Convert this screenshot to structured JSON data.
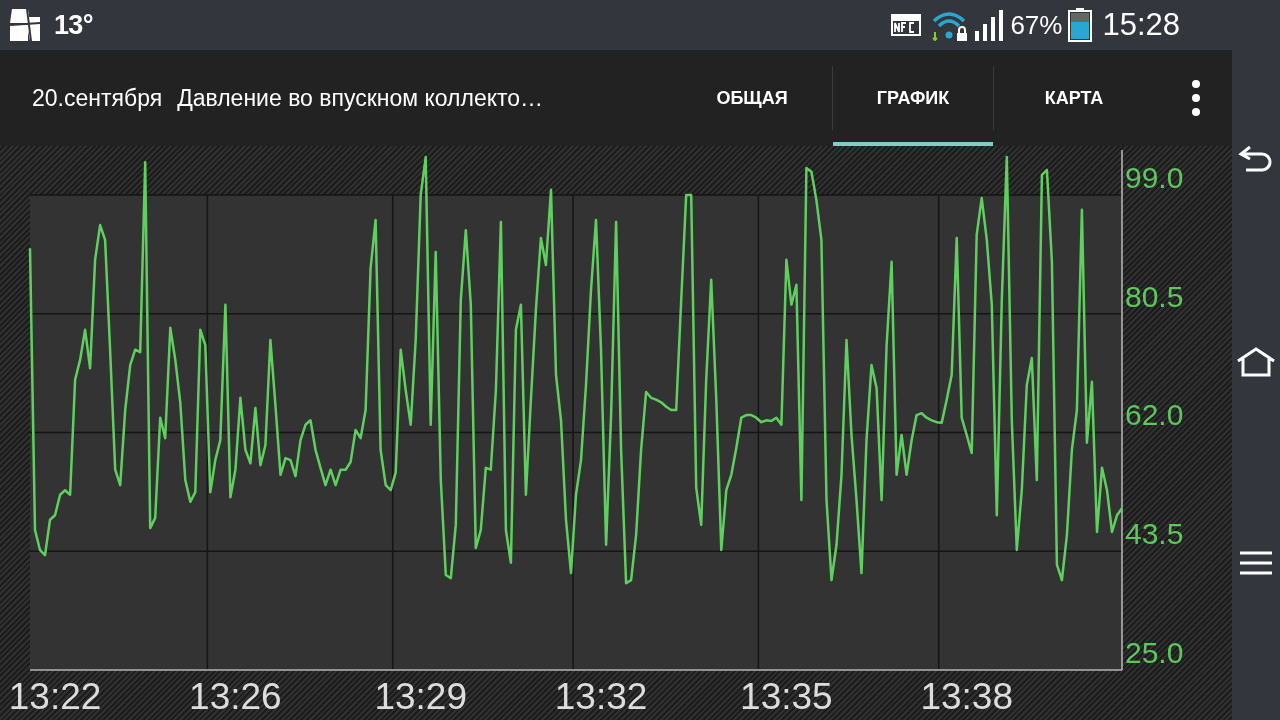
{
  "status_bar": {
    "temperature": "13°",
    "battery": "67%",
    "time": "15:28"
  },
  "action_bar": {
    "date": "20.сентября",
    "title": "Давление во впускном коллекто…",
    "tabs": [
      {
        "label": "ОБЩАЯ",
        "selected": false
      },
      {
        "label": "ГРАФИК",
        "selected": true
      },
      {
        "label": "КАРТА",
        "selected": false
      }
    ]
  },
  "chart_data": {
    "type": "line",
    "grid": true,
    "ylim": [
      25,
      106
    ],
    "categories": [
      null,
      null,
      null,
      null,
      null,
      "13:22",
      null,
      null,
      null,
      null,
      null,
      null,
      null,
      null,
      null,
      null,
      null,
      null,
      null,
      null,
      null,
      null,
      null,
      null,
      null,
      null,
      null,
      null,
      null,
      null,
      null,
      null,
      null,
      null,
      null,
      null,
      null,
      null,
      null,
      null,
      null,
      "13:26",
      null,
      null,
      null,
      null,
      null,
      null,
      null,
      null,
      null,
      null,
      null,
      null,
      null,
      null,
      null,
      null,
      null,
      null,
      null,
      null,
      null,
      null,
      null,
      null,
      null,
      null,
      null,
      null,
      null,
      null,
      null,
      null,
      null,
      null,
      null,
      null,
      "13:29",
      null,
      null,
      null,
      null,
      null,
      null,
      null,
      null,
      null,
      null,
      null,
      null,
      null,
      null,
      null,
      null,
      null,
      null,
      null,
      null,
      null,
      null,
      null,
      null,
      null,
      null,
      null,
      null,
      null,
      null,
      null,
      null,
      null,
      null,
      null,
      "13:32",
      null,
      null,
      null,
      null,
      null,
      null,
      null,
      null,
      null,
      null,
      null,
      null,
      null,
      null,
      null,
      null,
      null,
      null,
      null,
      null,
      null,
      null,
      null,
      null,
      null,
      null,
      null,
      null,
      null,
      null,
      null,
      null,
      null,
      null,
      null,
      null,
      "13:35",
      null,
      null,
      null,
      null,
      null,
      null,
      null,
      null,
      null,
      null,
      null,
      null,
      null,
      null,
      null,
      null,
      null,
      null,
      null,
      null,
      null,
      null,
      null,
      null,
      null,
      null,
      null,
      null,
      null,
      null,
      null,
      null,
      null,
      null,
      null,
      "13:38",
      null,
      null,
      null,
      null,
      null,
      null,
      null,
      null,
      null,
      null,
      null,
      null,
      null,
      null,
      null,
      null,
      null,
      null,
      null,
      null,
      null,
      null,
      null,
      null,
      null,
      null,
      null,
      null,
      null,
      null,
      null
    ],
    "yticks": [
      {
        "value": 25,
        "label": "25.0"
      },
      {
        "value": 43.5,
        "label": "43.5"
      },
      {
        "value": 62,
        "label": "62.0"
      },
      {
        "value": 80.5,
        "label": "80.5"
      },
      {
        "value": 99,
        "label": "99.0"
      }
    ],
    "series": [
      {
        "color": "#5fcf5f",
        "values": [
          90.7,
          46.8,
          43.7,
          42.9,
          48.4,
          49.1,
          52.3,
          53.0,
          52.3,
          70.2,
          73.3,
          78.0,
          72.0,
          88.9,
          94.3,
          92.0,
          74.9,
          56.2,
          53.8,
          65.5,
          72.5,
          74.9,
          74.5,
          104.1,
          47.1,
          48.7,
          64.3,
          61.1,
          78.3,
          73.3,
          66.6,
          54.6,
          51.2,
          52.7,
          78.0,
          75.6,
          52.7,
          57.7,
          60.8,
          81.9,
          51.9,
          56.2,
          67.4,
          59.3,
          57.2,
          65.8,
          56.9,
          60.0,
          76.4,
          66.3,
          55.4,
          58.0,
          57.7,
          55.2,
          60.8,
          63.2,
          63.9,
          59.3,
          56.5,
          53.8,
          56.2,
          53.8,
          56.2,
          56.2,
          57.4,
          62.4,
          61.1,
          65.5,
          87.6,
          95.1,
          59.3,
          53.8,
          53.0,
          55.8,
          74.9,
          68.6,
          63.2,
          76.4,
          99.0,
          104.9,
          63.2,
          90.1,
          54.6,
          39.8,
          39.3,
          47.6,
          82.6,
          93.5,
          81.9,
          44.0,
          46.8,
          56.5,
          56.2,
          68.6,
          94.8,
          46.8,
          41.7,
          78.0,
          81.9,
          52.3,
          67.1,
          81.1,
          92.3,
          88.1,
          99.8,
          71.0,
          63.9,
          48.4,
          40.1,
          52.3,
          57.7,
          69.4,
          84.2,
          95.1,
          74.9,
          44.5,
          64.7,
          94.8,
          59.3,
          38.5,
          39.0,
          46.0,
          59.3,
          68.3,
          67.4,
          67.1,
          66.7,
          66.0,
          65.5,
          65.5,
          82.6,
          99.0,
          99.0,
          53.4,
          47.6,
          70.2,
          85.8,
          67.1,
          43.7,
          53.0,
          55.4,
          59.6,
          64.3,
          64.7,
          64.7,
          64.3,
          63.6,
          63.9,
          63.8,
          64.3,
          63.2,
          88.9,
          81.9,
          85.0,
          51.5,
          103.2,
          102.6,
          98.2,
          92.0,
          51.5,
          39.0,
          44.5,
          55.4,
          76.4,
          61.6,
          51.5,
          40.1,
          60.8,
          72.5,
          68.9,
          51.5,
          75.6,
          88.6,
          55.4,
          61.6,
          55.4,
          60.8,
          64.7,
          65.0,
          64.3,
          63.9,
          63.6,
          63.5,
          67.1,
          71.0,
          92.3,
          64.3,
          61.6,
          58.8,
          92.8,
          98.5,
          92.0,
          81.9,
          49.1,
          82.6,
          104.9,
          63.9,
          43.7,
          53.0,
          69.4,
          73.6,
          54.6,
          102.1,
          102.9,
          88.6,
          41.4,
          39.0,
          46.0,
          59.3,
          65.5,
          96.7,
          60.4,
          69.9,
          46.5,
          56.5,
          53.0,
          46.5,
          49.1,
          50.2
        ]
      }
    ]
  }
}
